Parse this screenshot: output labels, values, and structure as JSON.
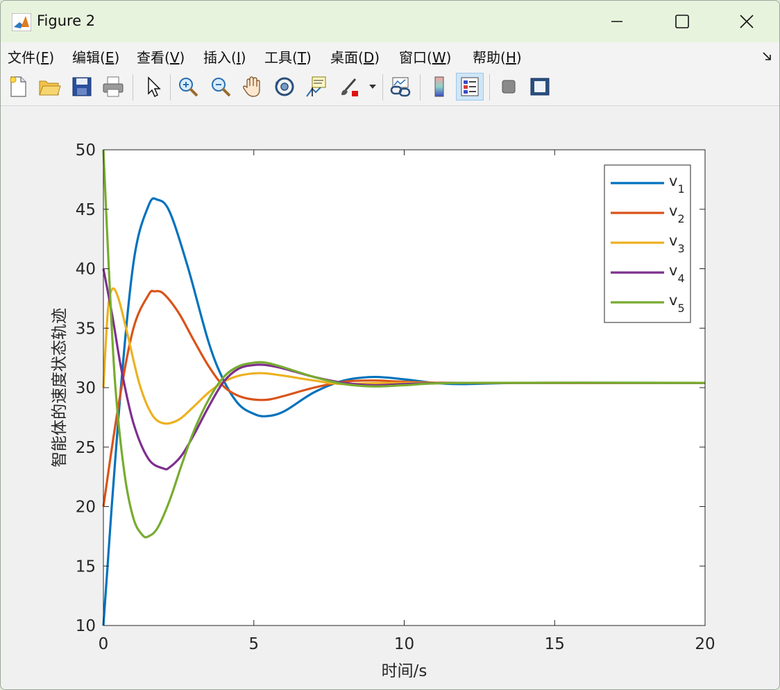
{
  "window": {
    "title": "Figure 2",
    "controls": [
      "minimize",
      "maximize",
      "close"
    ]
  },
  "menu": [
    {
      "pre": "文件(",
      "key": "F",
      "post": ")"
    },
    {
      "pre": "编辑(",
      "key": "E",
      "post": ")"
    },
    {
      "pre": "查看(",
      "key": "V",
      "post": ")"
    },
    {
      "pre": "插入(",
      "key": "I",
      "post": ")"
    },
    {
      "pre": "工具(",
      "key": "T",
      "post": ")"
    },
    {
      "pre": "桌面(",
      "key": "D",
      "post": ")"
    },
    {
      "pre": "窗口(",
      "key": "W",
      "post": ")"
    },
    {
      "pre": "帮助(",
      "key": "H",
      "post": ")"
    }
  ],
  "toolbar": {
    "icons": [
      "new-figure-icon",
      "open-file-icon",
      "save-icon",
      "print-icon",
      "pointer-icon",
      "zoom-in-icon",
      "zoom-out-icon",
      "pan-hand-icon",
      "rotate-3d-icon",
      "data-cursor-icon",
      "brush-icon",
      "link-plot-icon",
      "colorbar-icon",
      "legend-icon",
      "hide-plot-tools-icon",
      "show-plot-tools-icon"
    ],
    "active": "legend-icon"
  },
  "chart_data": {
    "type": "line",
    "title": "",
    "xlabel": "时间/s",
    "ylabel": "智能体的速度状态轨迹",
    "xlim": [
      0,
      20
    ],
    "ylim": [
      10,
      50
    ],
    "xticks": [
      0,
      5,
      10,
      15,
      20
    ],
    "yticks": [
      10,
      15,
      20,
      25,
      30,
      35,
      40,
      45,
      50
    ],
    "grid": false,
    "legend_position": "top-right",
    "series": [
      {
        "name": "v",
        "sub": "1",
        "color": "#0072bd",
        "x": [
          0,
          0.5,
          1.0,
          1.5,
          1.8,
          2.2,
          2.8,
          3.5,
          4.0,
          4.5,
          5.0,
          5.4,
          6.0,
          7.0,
          8.0,
          9.0,
          10.0,
          11.0,
          12.0,
          14.0,
          20.0
        ],
        "y": [
          10,
          27.5,
          40.5,
          45.3,
          45.8,
          44.8,
          40.2,
          33.8,
          30.6,
          28.6,
          27.8,
          27.6,
          28.0,
          29.6,
          30.6,
          30.9,
          30.7,
          30.4,
          30.3,
          30.4,
          30.4
        ]
      },
      {
        "name": "v",
        "sub": "2",
        "color": "#d95319",
        "x": [
          0,
          0.5,
          1.0,
          1.5,
          1.7,
          2.0,
          2.5,
          3.0,
          3.5,
          4.0,
          4.5,
          5.0,
          5.5,
          6.0,
          7.0,
          8.0,
          9.0,
          10.0,
          12.0,
          20.0
        ],
        "y": [
          20,
          28.5,
          35.0,
          37.8,
          38.1,
          37.9,
          36.3,
          34.0,
          31.8,
          30.1,
          29.3,
          29.0,
          29.0,
          29.3,
          30.0,
          30.5,
          30.6,
          30.5,
          30.4,
          30.4
        ]
      },
      {
        "name": "v",
        "sub": "3",
        "color": "#edb120",
        "x": [
          0,
          0.15,
          0.3,
          0.5,
          0.8,
          1.2,
          1.6,
          2.0,
          2.5,
          3.0,
          3.5,
          4.0,
          4.5,
          5.0,
          5.4,
          6.0,
          7.0,
          8.0,
          10.0,
          20.0
        ],
        "y": [
          30,
          36.5,
          38.3,
          37.5,
          34.5,
          30.3,
          27.8,
          27.0,
          27.3,
          28.4,
          29.6,
          30.5,
          31.0,
          31.2,
          31.2,
          31.0,
          30.6,
          30.3,
          30.4,
          30.4
        ]
      },
      {
        "name": "v",
        "sub": "4",
        "color": "#7e2f8e",
        "x": [
          0,
          0.3,
          0.6,
          1.0,
          1.5,
          2.0,
          2.2,
          2.6,
          3.0,
          3.5,
          4.0,
          4.5,
          5.0,
          5.4,
          6.0,
          7.0,
          8.0,
          9.0,
          10.0,
          12.0,
          20.0
        ],
        "y": [
          40,
          36.0,
          31.5,
          27.0,
          24.0,
          23.2,
          23.3,
          24.3,
          26.0,
          28.4,
          30.5,
          31.6,
          31.9,
          31.9,
          31.6,
          30.9,
          30.4,
          30.2,
          30.3,
          30.4,
          30.4
        ]
      },
      {
        "name": "v",
        "sub": "5",
        "color": "#77ac30",
        "x": [
          0,
          0.2,
          0.4,
          0.7,
          1.0,
          1.3,
          1.5,
          1.8,
          2.2,
          2.6,
          3.0,
          3.5,
          4.0,
          4.5,
          5.0,
          5.4,
          6.0,
          7.0,
          8.0,
          9.0,
          10.0,
          12.0,
          20.0
        ],
        "y": [
          50,
          39.0,
          30.0,
          22.8,
          19.0,
          17.6,
          17.5,
          18.2,
          20.5,
          23.5,
          26.3,
          29.0,
          30.9,
          31.8,
          32.1,
          32.1,
          31.7,
          30.9,
          30.3,
          30.1,
          30.2,
          30.4,
          30.4
        ]
      }
    ]
  }
}
